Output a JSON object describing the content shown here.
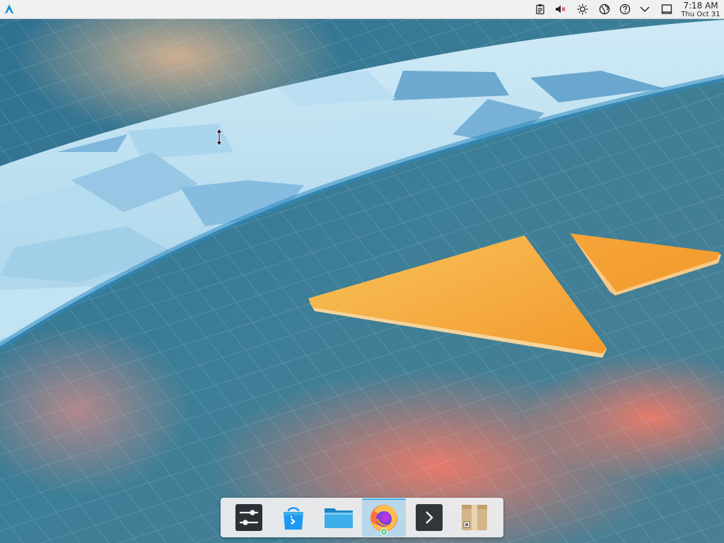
{
  "desktop": {
    "wallpaper_icon": "plasma-wallpaper",
    "cursor_icon": "vertical-resize-cursor"
  },
  "top_panel": {
    "launcher_icon": "arch-logo-icon",
    "tray": [
      {
        "name": "clipboard-icon"
      },
      {
        "name": "volume-muted-icon"
      },
      {
        "name": "brightness-icon"
      },
      {
        "name": "network-globe-icon"
      },
      {
        "name": "help-icon"
      },
      {
        "name": "chevron-down-icon"
      },
      {
        "name": "show-desktop-icon"
      }
    ],
    "clock": {
      "time": "7:18 AM",
      "date": "Thu Oct 31"
    }
  },
  "dock": {
    "items": [
      {
        "name": "system-settings-icon",
        "active": false
      },
      {
        "name": "discover-store-icon",
        "active": false
      },
      {
        "name": "file-manager-icon",
        "active": false
      },
      {
        "name": "firefox-icon",
        "active": true
      },
      {
        "name": "terminal-icon",
        "active": false
      },
      {
        "name": "package-installer-icon",
        "active": false
      }
    ]
  },
  "colors": {
    "panel_bg": "#eff0f1",
    "accent": "#3daee9",
    "wallpaper_blue": "#3f7d96",
    "wallpaper_orange": "#f4a53a"
  }
}
